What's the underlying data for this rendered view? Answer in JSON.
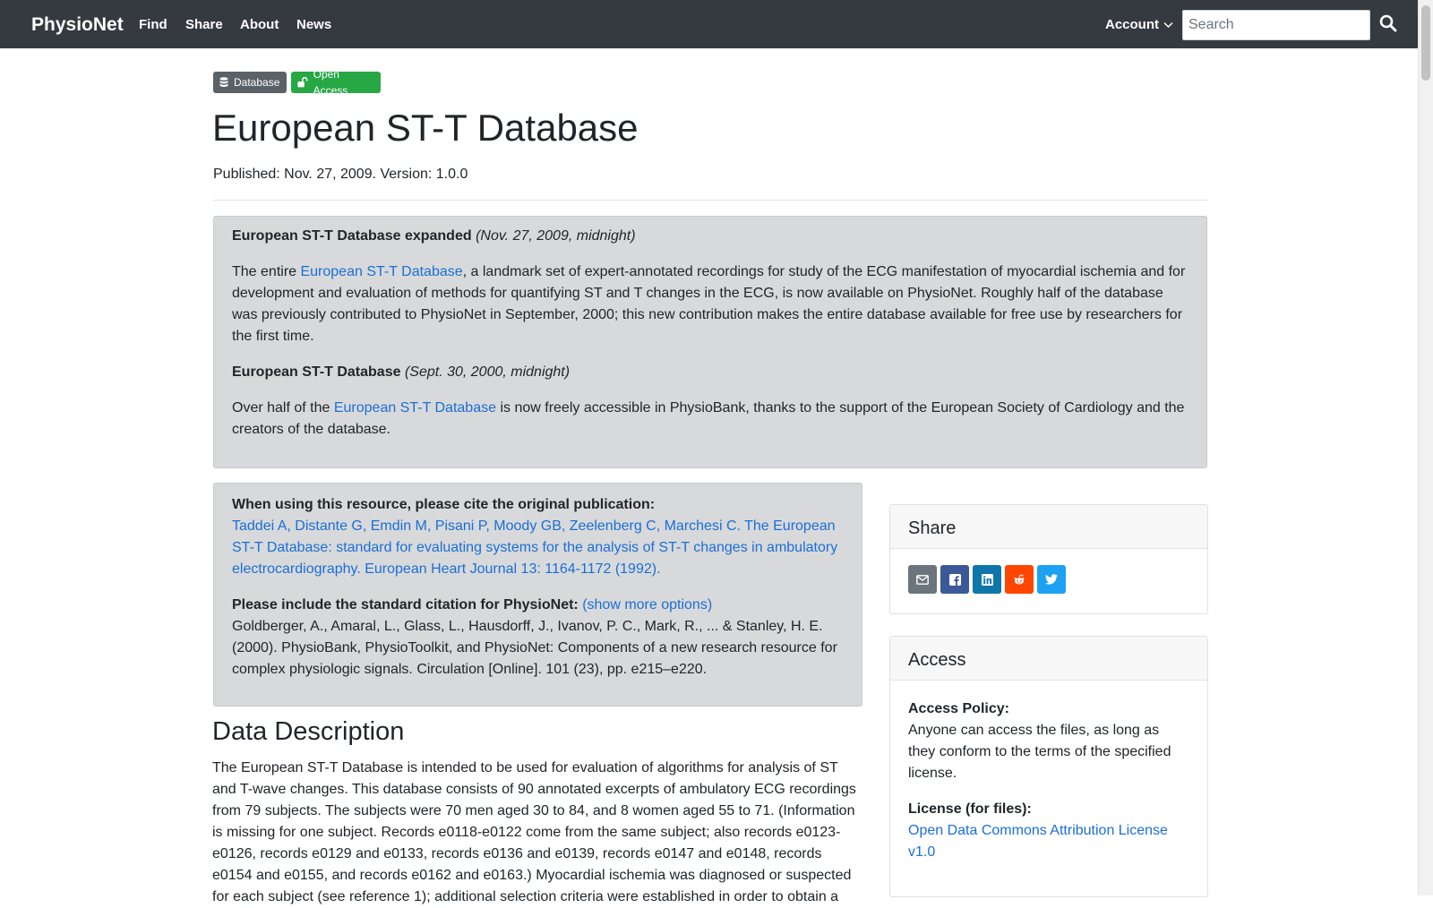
{
  "navbar": {
    "brand": "PhysioNet",
    "items": [
      "Find",
      "Share",
      "About",
      "News"
    ],
    "account": "Account",
    "search_placeholder": "Search"
  },
  "badges": {
    "database": "Database",
    "open_access": "Open Access"
  },
  "title": "European ST-T Database",
  "published": "Published: Nov. 27, 2009. Version: 1.0.0",
  "news": {
    "item1_title": "European ST-T Database expanded",
    "item1_date": "(Nov. 27, 2009, midnight)",
    "item1_pre": "The entire ",
    "item1_link": "European ST-T Database",
    "item1_post": ", a landmark set of expert-annotated recordings for study of the ECG manifestation of myocardial ischemia and for development and evaluation of methods for quantifying ST and T changes in the ECG, is now available on PhysioNet. Roughly half of the database was previously contributed to PhysioNet in September, 2000; this new contribution makes the entire database available for free use by researchers for the first time.",
    "item2_title": "European ST-T Database",
    "item2_date": "(Sept. 30, 2000, midnight)",
    "item2_pre": "Over half of the ",
    "item2_link": "European ST-T Database",
    "item2_post": " is now freely accessible in PhysioBank, thanks to the support of the European Society of Cardiology and the creators of the database."
  },
  "citation": {
    "heading": "When using this resource, please cite the original publication:",
    "original": "Taddei A, Distante G, Emdin M, Pisani P, Moody GB, Zeelenberg C, Marchesi C. The European ST-T Database: standard for evaluating systems for the analysis of ST-T changes in ambulatory electrocardiography. European Heart Journal 13: 1164-1172 (1992).",
    "standard_heading": "Please include the standard citation for PhysioNet:",
    "show_more": "(show more options)",
    "standard": "Goldberger, A., Amaral, L., Glass, L., Hausdorff, J., Ivanov, P. C., Mark, R., ... & Stanley, H. E. (2000). PhysioBank, PhysioToolkit, and PhysioNet: Components of a new research resource for complex physiologic signals. Circulation [Online]. 101 (23), pp. e215–e220."
  },
  "data_description": {
    "heading": "Data Description",
    "text": "The European ST-T Database is intended to be used for evaluation of algorithms for analysis of ST and T-wave changes. This database consists of 90 annotated excerpts of ambulatory ECG recordings from 79 subjects. The subjects were 70 men aged 30 to 84, and 8 women aged 55 to 71. (Information is missing for one subject. Records e0118-e0122 come from the same subject; also records e0123-e0126, records e0129 and e0133, records e0136 and e0139, records e0147 and e0148, records e0154 and e0155, and records e0162 and e0163.) Myocardial ischemia was diagnosed or suspected for each subject (see reference 1); additional selection criteria were established in order to obtain a"
  },
  "share": {
    "title": "Share"
  },
  "access": {
    "title": "Access",
    "policy_label": "Access Policy:",
    "policy_text": "Anyone can access the files, as long as they conform to the terms of the specified license.",
    "license_label": "License (for files):",
    "license_link": "Open Data Commons Attribution License v1.0"
  }
}
